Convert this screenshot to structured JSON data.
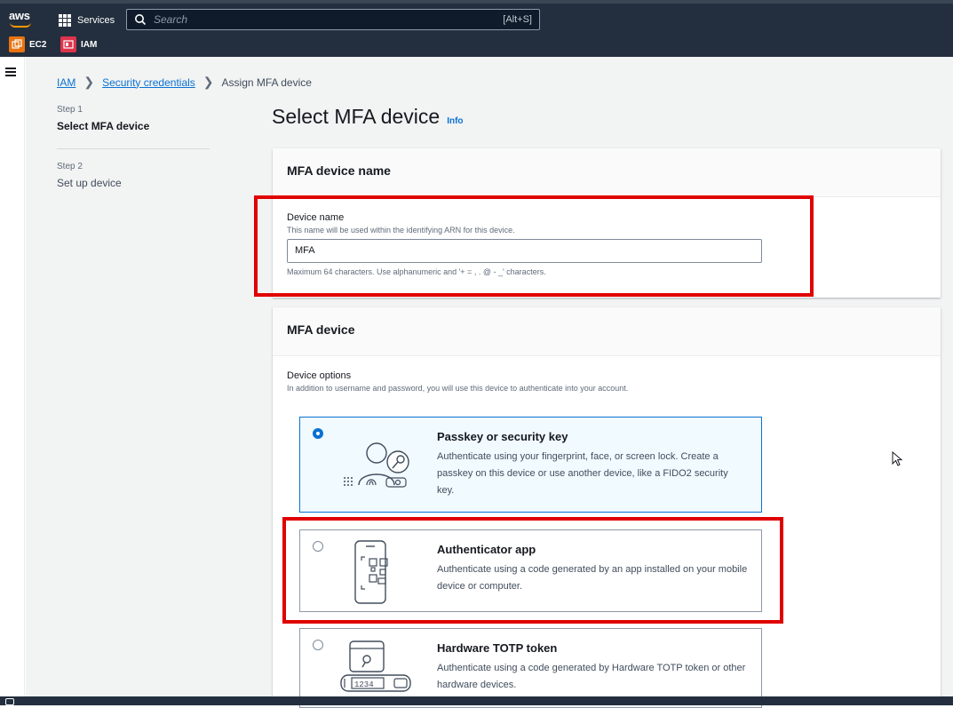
{
  "nav": {
    "logo": "aws",
    "services_label": "Services",
    "search_placeholder": "Search",
    "search_shortcut": "[Alt+S]",
    "favorites": [
      {
        "label": "EC2",
        "color": "#e8730e"
      },
      {
        "label": "IAM",
        "color": "#dd344c"
      }
    ]
  },
  "breadcrumb": {
    "items": [
      "IAM",
      "Security credentials",
      "Assign MFA device"
    ]
  },
  "steps": [
    {
      "num": "Step 1",
      "title": "Select MFA device"
    },
    {
      "num": "Step 2",
      "title": "Set up device"
    }
  ],
  "page": {
    "title": "Select MFA device",
    "info": "Info"
  },
  "name_panel": {
    "header": "MFA device name",
    "field_label": "Device name",
    "field_desc": "This name will be used within the identifying ARN for this device.",
    "field_value": "MFA",
    "constraint": "Maximum 64 characters. Use alphanumeric and '+ = , . @ - _' characters."
  },
  "device_panel": {
    "header": "MFA device",
    "options_label": "Device options",
    "options_desc": "In addition to username and password, you will use this device to authenticate into your account.",
    "options": [
      {
        "title": "Passkey or security key",
        "desc": "Authenticate using your fingerprint, face, or screen lock. Create a passkey on this device or use another device, like a FIDO2 security key.",
        "icon": "passkey-icon",
        "selected": true
      },
      {
        "title": "Authenticator app",
        "desc": "Authenticate using a code generated by an app installed on your mobile device or computer.",
        "icon": "authenticator-app-icon",
        "selected": false
      },
      {
        "title": "Hardware TOTP token",
        "desc": "Authenticate using a code generated by Hardware TOTP token or other hardware devices.",
        "icon": "hardware-token-icon",
        "token_code": "1234",
        "selected": false
      }
    ]
  },
  "colors": {
    "nav_bg": "#232f3e",
    "link": "#0972d3",
    "highlight": "#e00000",
    "selected_bg": "#f1faff"
  }
}
